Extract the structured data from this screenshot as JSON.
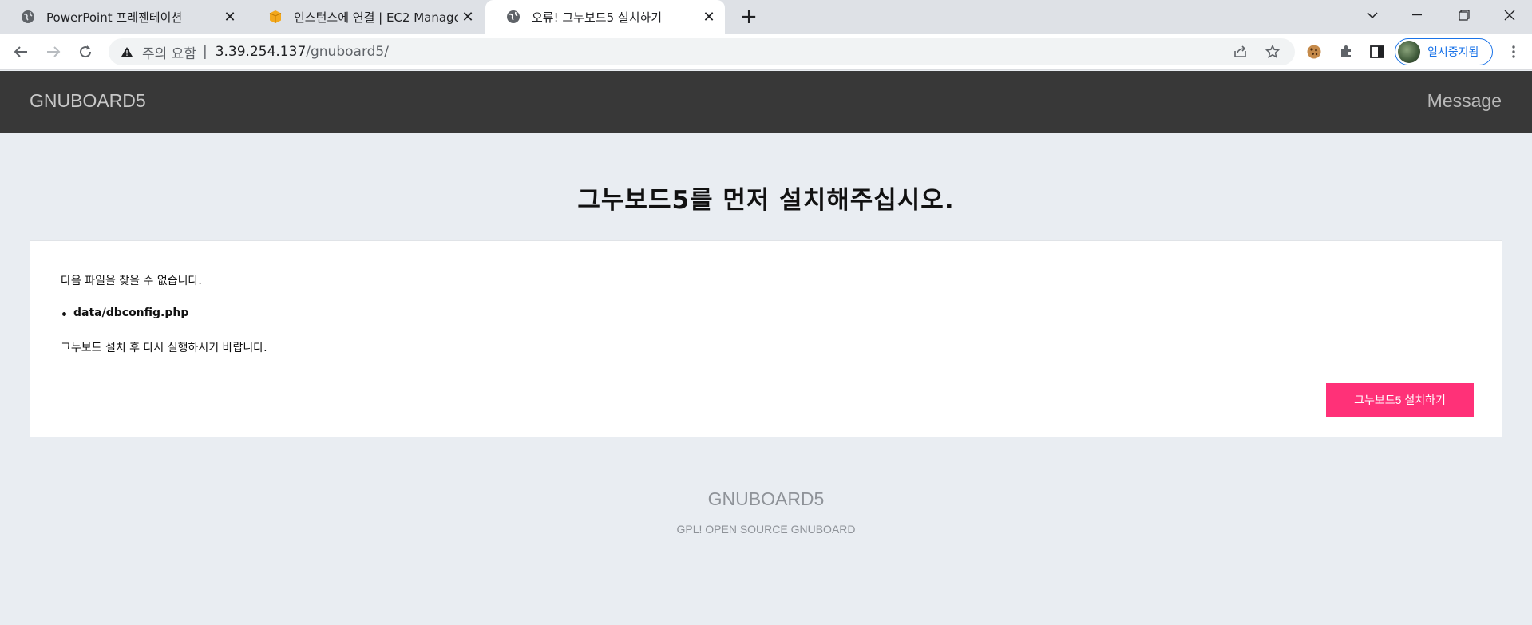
{
  "browser": {
    "tabs": [
      {
        "title": "PowerPoint 프레젠테이션",
        "icon": "globe-icon",
        "active": false
      },
      {
        "title": "인스턴스에 연결 | EC2 Managem",
        "icon": "aws-box-icon",
        "active": false
      },
      {
        "title": "오류! 그누보드5 설치하기",
        "icon": "globe-icon",
        "active": true
      }
    ],
    "omnibox": {
      "security_label": "주의 요함",
      "url_host": "3.39.254.137",
      "url_path": "/gnuboard5/"
    },
    "profile_label": "일시중지됨"
  },
  "header": {
    "logo": "GNUBOARD5",
    "message_link": "Message"
  },
  "main": {
    "title": "그누보드5를 먼저 설치해주십시오.",
    "missing_message": "다음 파일을 찾을 수 없습니다.",
    "missing_files": [
      "data/dbconfig.php"
    ],
    "retry_message": "그누보드 설치 후 다시 실행하시기 바랍니다.",
    "install_button": "그누보드5 설치하기"
  },
  "footer": {
    "logo": "GNUBOARD5",
    "subtitle": "GPL! OPEN SOURCE GNUBOARD"
  },
  "colors": {
    "header_bg": "#383838",
    "page_bg": "#e9edf2",
    "button_bg": "#ff3178",
    "profile_accent": "#1a73e8"
  }
}
